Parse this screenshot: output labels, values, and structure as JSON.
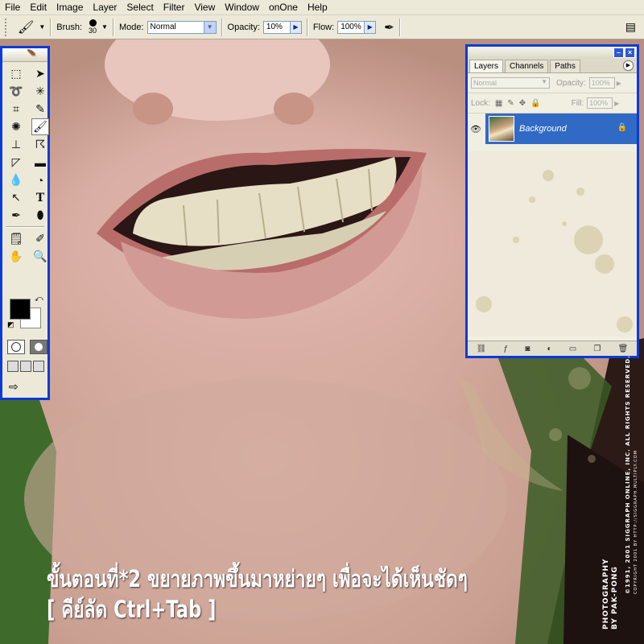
{
  "menubar": {
    "items": [
      "File",
      "Edit",
      "Image",
      "Layer",
      "Select",
      "Filter",
      "View",
      "Window",
      "onOne",
      "Help"
    ]
  },
  "options": {
    "brush_label": "Brush:",
    "brush_size": "30",
    "mode_label": "Mode:",
    "mode_value": "Normal",
    "opacity_label": "Opacity:",
    "opacity_value": "10%",
    "flow_label": "Flow:",
    "flow_value": "100%"
  },
  "layers_panel": {
    "tabs": [
      "Layers",
      "Channels",
      "Paths"
    ],
    "blend_mode": "Normal",
    "opacity_label": "Opacity:",
    "opacity_value": "100%",
    "lock_label": "Lock:",
    "fill_label": "Fill:",
    "fill_value": "100%",
    "layer_name": "Background"
  },
  "caption": {
    "line1": "ขั้นตอนที่*2 ขยายภาพขึ้นมาหย่ายๆ เพื่อจะได้เห็นชัดๆ",
    "line2": "[ คีย์ลัด Ctrl+Tab ]"
  },
  "credits": {
    "copyright_line1": "©1991, 2001 SIGGRAPH ONLINE, INC. ALL RIGHTS RESERVED.",
    "copyright_line2": "COPYRIGHT 2001 BY HTTP://SIGGRAPH.MULTIPLY.COM",
    "brand_line1": "PHOTOGRAPHY",
    "brand_line2": "BY PAK-PONG"
  },
  "colors": {
    "foreground": "#000000",
    "background": "#ffffff",
    "palette_border": "#0a3bd8",
    "layer_selected": "#316ac5"
  }
}
